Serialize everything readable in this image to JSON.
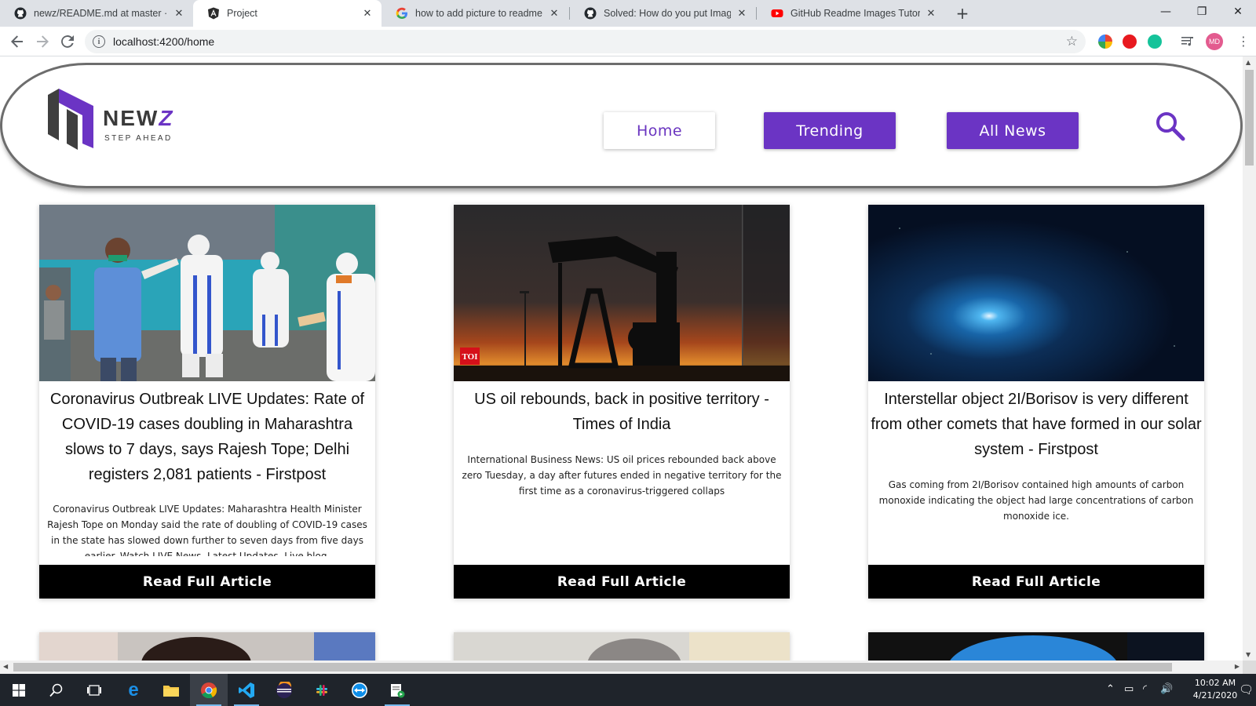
{
  "browser": {
    "tabs": [
      {
        "title": "newz/README.md at master · sh",
        "icon": "github-icon",
        "active": false
      },
      {
        "title": "Project",
        "icon": "angular-icon",
        "active": true
      },
      {
        "title": "how to add picture to readme gi",
        "icon": "google-icon",
        "active": false
      },
      {
        "title": "Solved: How do you put Images",
        "icon": "github-icon",
        "active": false
      },
      {
        "title": "GitHub Readme Images Tutorial",
        "icon": "youtube-icon",
        "active": false
      }
    ],
    "url": "localhost:4200/home",
    "profile_initials": "MD"
  },
  "site": {
    "logo": {
      "word": "NEW",
      "accent": "Z",
      "tagline": "STEP AHEAD"
    },
    "nav": [
      {
        "label": "Home",
        "active": true
      },
      {
        "label": "Trending",
        "active": false
      },
      {
        "label": "All News",
        "active": false
      }
    ],
    "colors": {
      "brand": "#6b34c4",
      "button_dark": "#000000"
    }
  },
  "articles": [
    {
      "title": "Coronavirus Outbreak LIVE Updates: Rate of COVID-19 cases doubling in Maharashtra slows to 7 days, says Rajesh Tope; Delhi registers 2,081 patients - Firstpost",
      "description": "Coronavirus Outbreak LIVE Updates: Maharashtra Health Minister Rajesh Tope on Monday said the rate of doubling of COVID-19 cases in the state has slowed down further to seven days from five days earlier. Watch LIVE News, Latest Updates, Live blog,",
      "button": "Read Full Article"
    },
    {
      "title": "US oil rebounds, back in positive territory - Times of India",
      "description": "International Business News: US oil prices rebounded back above zero Tuesday, a day after futures ended in negative territory for the first time as a coronavirus-triggered collaps",
      "button": "Read Full Article",
      "image_badge": "TOI"
    },
    {
      "title": "Interstellar object 2I/Borisov is very different from other comets that have formed in our solar system - Firstpost",
      "description": "Gas coming from 2I/Borisov contained high amounts of carbon monoxide indicating the object had large concentrations of carbon monoxide ice.",
      "button": "Read Full Article"
    }
  ],
  "taskbar": {
    "time": "10:02 AM",
    "date": "4/21/2020"
  }
}
